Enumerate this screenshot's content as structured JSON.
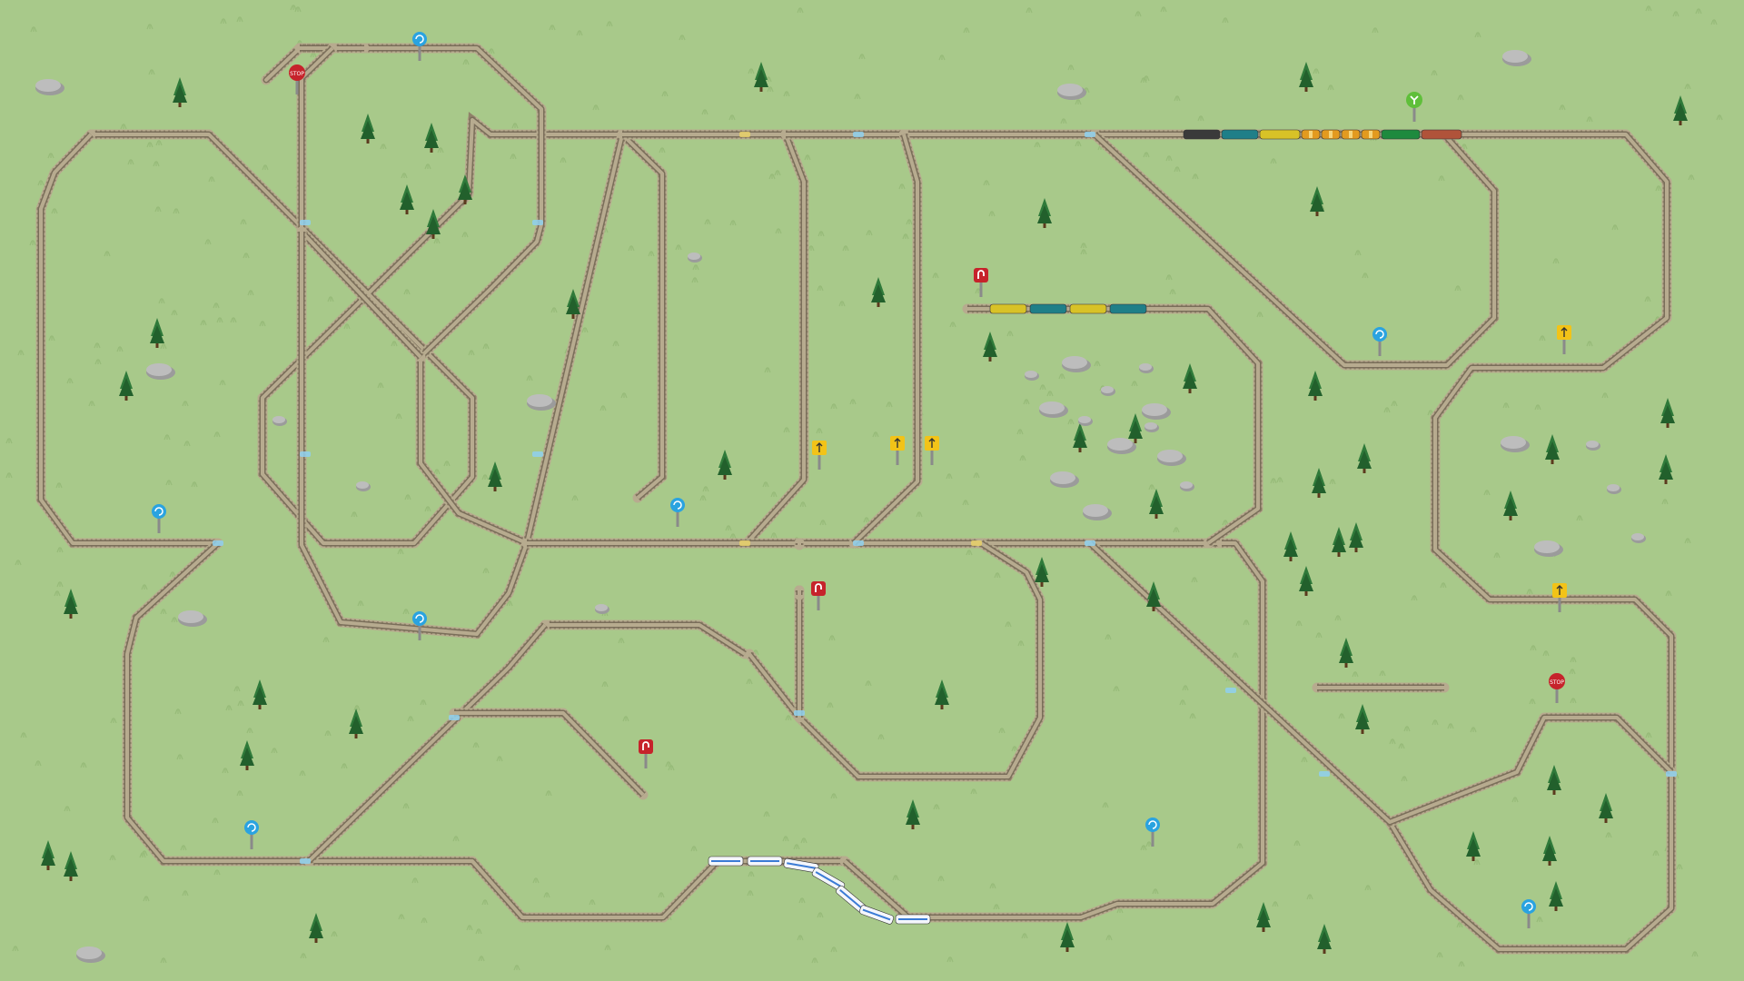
{
  "game": {
    "type": "train-layout",
    "colors": {
      "grass": "#a8c98a",
      "grass_tuft": "#97bb79",
      "ballast": "#b7ab8f",
      "rail": "#7a6e5a",
      "sleeper": "#8f8169",
      "tree": "#2f7a3a",
      "tree_dark": "#22602c",
      "rock": "#bdbdbd",
      "rock_shadow": "#9b9b9b",
      "sign_blue": "#2aa3e0",
      "sign_red": "#c6232b",
      "sign_yellow": "#f2c318",
      "sign_green": "#5fbf3a",
      "switch_yellow": "#e8d06a",
      "switch_blue": "#8fd0ee"
    },
    "sign_texts": {
      "stop": "STOP"
    },
    "sign_kinds": [
      "stop-sign",
      "rotate-sign",
      "reverse-sign",
      "speed-sign",
      "direction-sign",
      "junction-sign"
    ],
    "trains": [
      {
        "name": "freight-train-main",
        "cars": [
          "locomotive",
          "tank-car",
          "flat-car",
          "box-car",
          "box-car",
          "box-car",
          "box-car",
          "passenger-car",
          "brake-car"
        ]
      },
      {
        "name": "freight-train-siding",
        "cars": [
          "flat-car",
          "tank-car",
          "flat-car",
          "tank-car"
        ]
      },
      {
        "name": "high-speed-train",
        "cars": [
          "hs-car",
          "hs-car",
          "hs-car",
          "hs-car",
          "hs-car",
          "hs-car",
          "hs-car"
        ]
      }
    ]
  }
}
